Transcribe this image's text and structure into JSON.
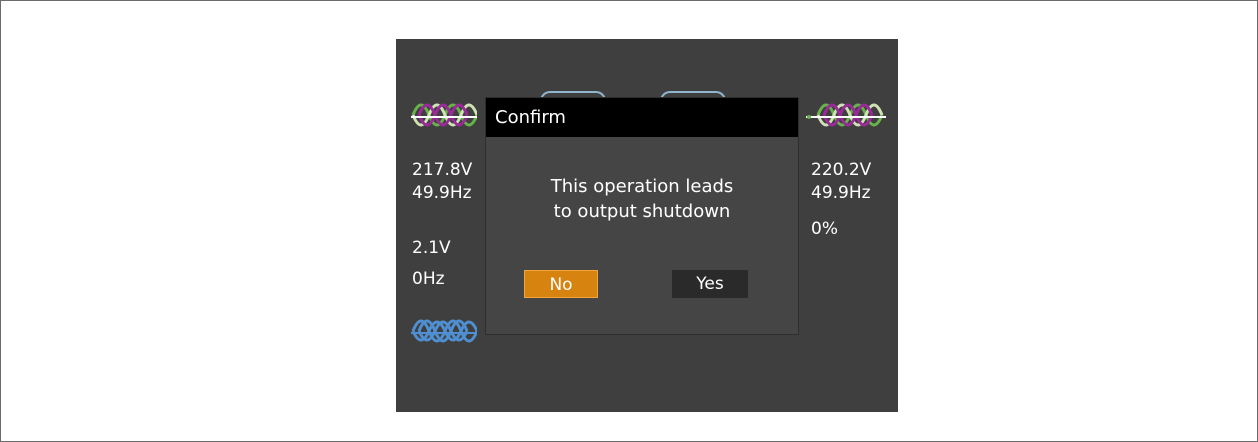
{
  "left": {
    "input_voltage": "217.8V",
    "input_freq": "49.9Hz",
    "bypass_voltage": "2.1V",
    "bypass_freq": "0Hz"
  },
  "right": {
    "output_voltage": "220.2V",
    "output_freq": "49.9Hz",
    "load_percent": "0%"
  },
  "dialog": {
    "title": "Confirm",
    "message_line1": "This operation leads",
    "message_line2": "to output shutdown",
    "no_label": "No",
    "yes_label": "Yes"
  },
  "colors": {
    "screen_bg": "#3f3f3f",
    "accent_orange": "#d6840f",
    "wave_purple": "#9a2a9a",
    "wave_green": "#67b34a",
    "wave_light": "#cfe2b4",
    "wave_blue": "#4f8fd1"
  }
}
